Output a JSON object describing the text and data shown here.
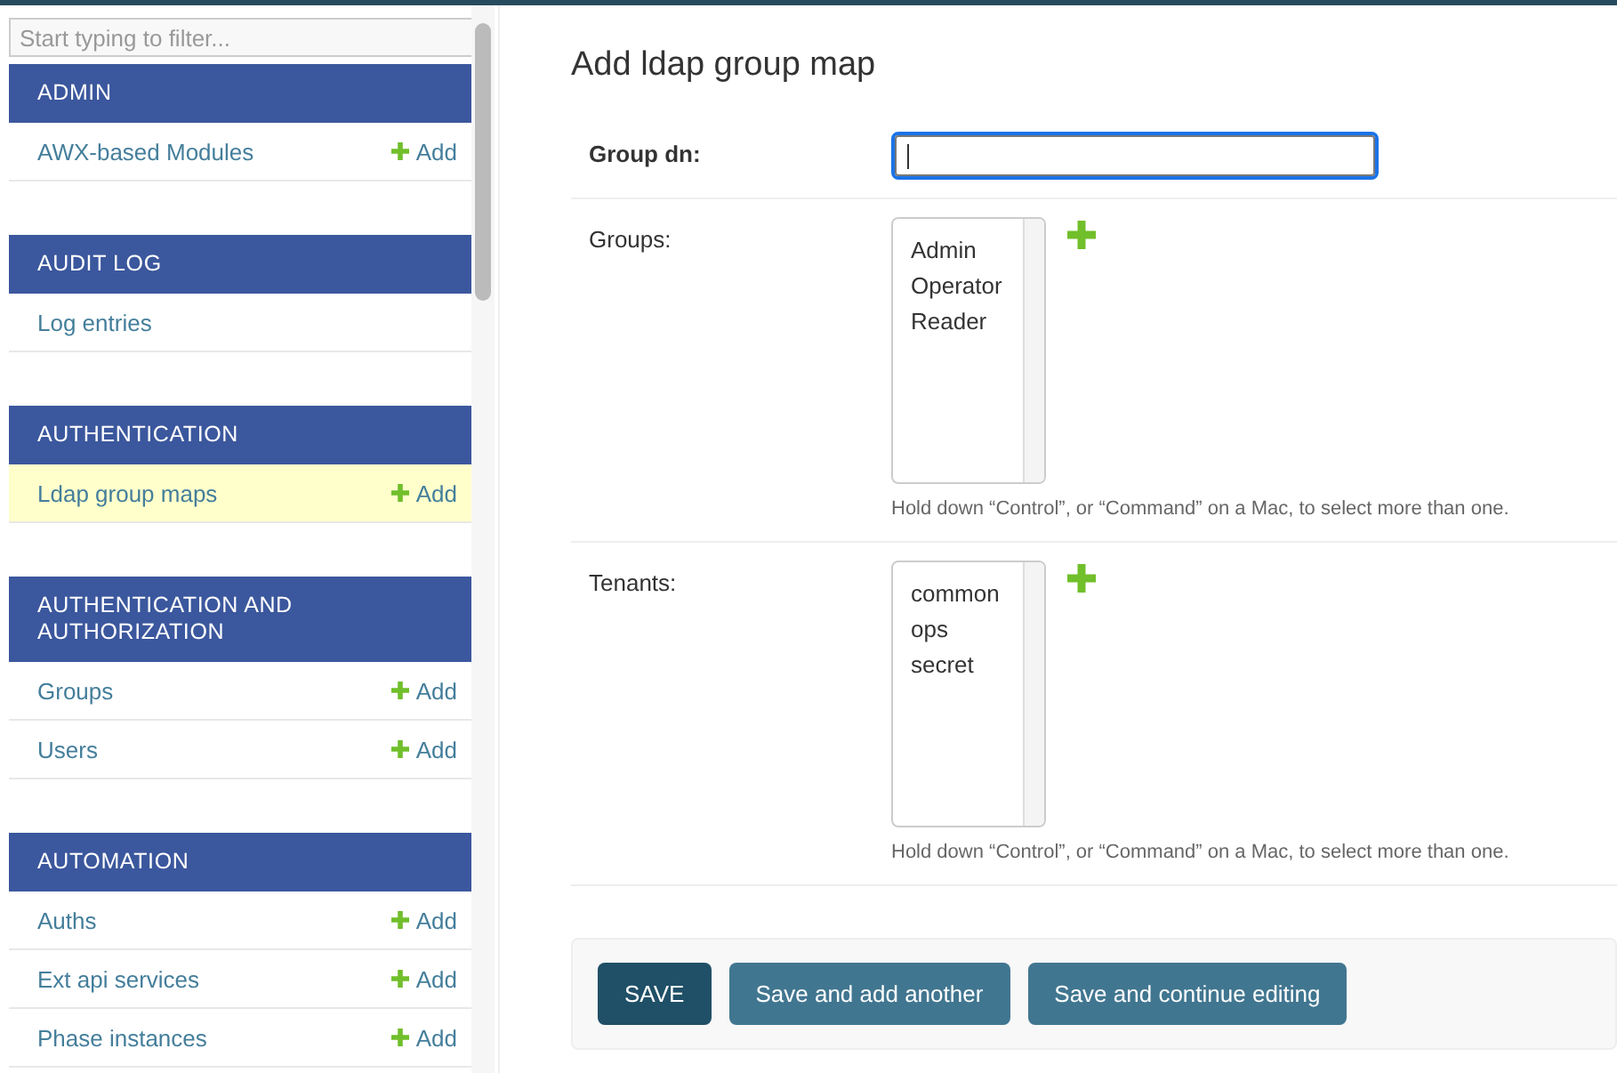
{
  "sidebar": {
    "filter": {
      "placeholder": "Start typing to filter..."
    },
    "modules": [
      {
        "name": "ADMIN",
        "items": [
          {
            "label": "AWX-based Modules",
            "add": "Add",
            "selected": false
          }
        ]
      },
      {
        "name": "AUDIT LOG",
        "items": [
          {
            "label": "Log entries",
            "selected": false
          }
        ]
      },
      {
        "name": "AUTHENTICATION",
        "items": [
          {
            "label": "Ldap group maps",
            "add": "Add",
            "selected": true
          }
        ]
      },
      {
        "name": "AUTHENTICATION AND AUTHORIZATION",
        "items": [
          {
            "label": "Groups",
            "add": "Add",
            "selected": false
          },
          {
            "label": "Users",
            "add": "Add",
            "selected": false
          }
        ]
      },
      {
        "name": "AUTOMATION",
        "items": [
          {
            "label": "Auths",
            "add": "Add",
            "selected": false
          },
          {
            "label": "Ext api services",
            "add": "Add",
            "selected": false
          },
          {
            "label": "Phase instances",
            "add": "Add",
            "selected": false
          }
        ]
      }
    ]
  },
  "main": {
    "title": "Add ldap group map",
    "fields": [
      {
        "kind": "text",
        "label": "Group dn:",
        "required": true,
        "focused": true
      },
      {
        "kind": "multiselect",
        "label": "Groups:",
        "required": false,
        "options": [
          "Admin",
          "Operator",
          "Reader"
        ],
        "help": "Hold down “Control”, or “Command” on a Mac, to select more than one."
      },
      {
        "kind": "multiselect",
        "label": "Tenants:",
        "required": false,
        "options": [
          "common",
          "ops",
          "secret"
        ],
        "help": "Hold down “Control”, or “Command” on a Mac, to select more than one."
      }
    ],
    "buttons": [
      {
        "label": "SAVE",
        "kind": "primary"
      },
      {
        "label": "Save and add another",
        "kind": "secondary"
      },
      {
        "label": "Save and continue editing",
        "kind": "secondary"
      }
    ]
  }
}
